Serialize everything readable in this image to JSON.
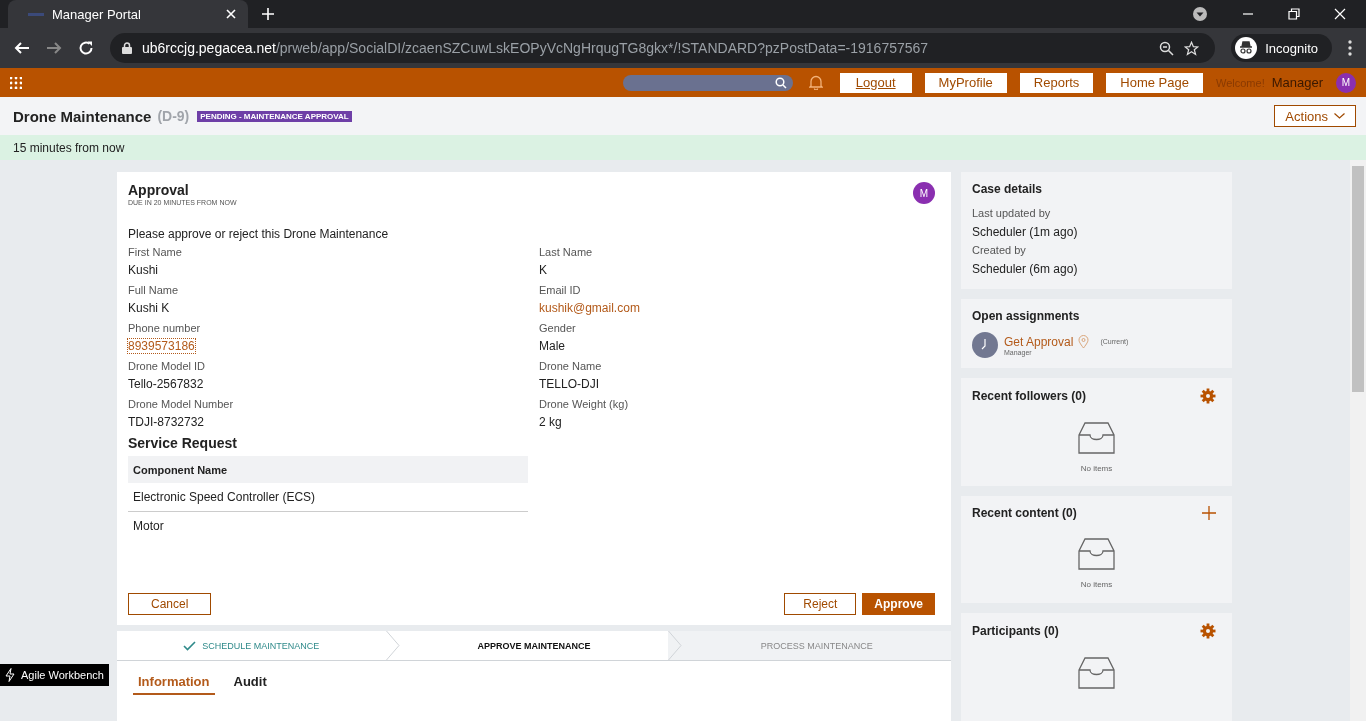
{
  "browser": {
    "tab_title": "Manager Portal",
    "url_host": "ub6rccjg.pegacea.net",
    "url_path": "/prweb/app/SocialDI/zcaenSZCuwLskEOPyVcNgHrqugTG8gkx*/!STANDARD?pzPostData=-1916757567",
    "incognito_label": "Incognito"
  },
  "nav": {
    "buttons": [
      "Logout",
      "MyProfile",
      "Reports",
      "Home Page"
    ],
    "welcome": "Welcome!",
    "user": "Manager",
    "avatar": "M"
  },
  "header": {
    "title": "Drone Maintenance",
    "case_id": "(D-9)",
    "status": "PENDING - MAINTENANCE APPROVAL",
    "actions": "Actions"
  },
  "banner": "15 minutes from now",
  "approval": {
    "title": "Approval",
    "due": "DUE IN 20 MINUTES FROM NOW",
    "avatar": "M",
    "instruction": "Please approve or reject this Drone Maintenance",
    "fields": [
      {
        "label": "First Name",
        "value": "Kushi",
        "kind": "text"
      },
      {
        "label": "Last Name",
        "value": "K",
        "kind": "text"
      },
      {
        "label": "Full Name",
        "value": "Kushi K",
        "kind": "text"
      },
      {
        "label": "Email ID",
        "value": "kushik@gmail.com",
        "kind": "link"
      },
      {
        "label": "Phone number",
        "value": "8939573186",
        "kind": "phone"
      },
      {
        "label": "Gender",
        "value": "Male",
        "kind": "text"
      },
      {
        "label": "Drone Model ID",
        "value": "Tello-2567832",
        "kind": "text"
      },
      {
        "label": "Drone Name",
        "value": "TELLO-DJI",
        "kind": "text"
      },
      {
        "label": "Drone Model Number",
        "value": "TDJI-8732732",
        "kind": "text"
      },
      {
        "label": "Drone Weight (kg)",
        "value": "2 kg",
        "kind": "text"
      }
    ],
    "service_request": {
      "title": "Service Request",
      "column": "Component Name",
      "rows": [
        "Electronic Speed Controller (ECS)",
        "Motor"
      ]
    },
    "cancel": "Cancel",
    "reject": "Reject",
    "approve": "Approve"
  },
  "stages": [
    {
      "label": "SCHEDULE MAINTENANCE",
      "completed": true,
      "selected": false
    },
    {
      "label": "APPROVE MAINTENANCE",
      "completed": false,
      "selected": true
    },
    {
      "label": "PROCESS MAINTENANCE",
      "completed": false,
      "selected": false
    }
  ],
  "tabs": [
    {
      "label": "Information",
      "selected": true
    },
    {
      "label": "Audit",
      "selected": false
    }
  ],
  "sidebar": {
    "case_details": {
      "title": "Case details",
      "items": [
        {
          "label": "Last updated by",
          "value": "Scheduler (1m ago)"
        },
        {
          "label": "Created by",
          "value": "Scheduler (6m ago)"
        }
      ]
    },
    "open_assignments": {
      "title": "Open assignments",
      "items": [
        {
          "name": "Get Approval",
          "role": "Manager",
          "status": "(Current)"
        }
      ]
    },
    "widgets": [
      {
        "title": "Recent followers (0)",
        "kind": "gear",
        "empty": "No items"
      },
      {
        "title": "Recent content (0)",
        "kind": "plus",
        "empty": "No items"
      },
      {
        "title": "Participants (0)",
        "kind": "gear"
      }
    ]
  },
  "agile_workbench": "Agile Workbench"
}
